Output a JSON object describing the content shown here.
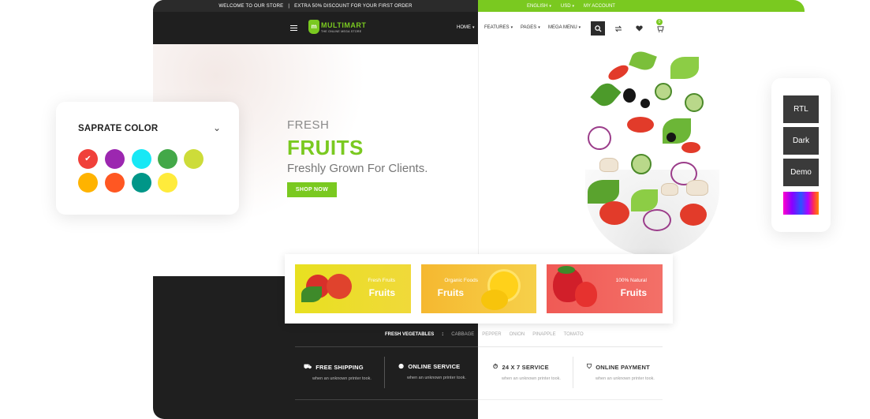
{
  "topbar": {
    "welcome": "WELCOME TO OUR STORE",
    "separator": "|",
    "discount": "EXTRA 50% DISCOUNT FOR YOUR FIRST ORDER",
    "language": "ENGLISH",
    "currency": "USD",
    "account": "MY ACCOUNT"
  },
  "header": {
    "logo_initial": "m",
    "logo_text": "MULTIMART",
    "logo_tagline": "THE ONLINE MEGA STORE",
    "nav": [
      "HOME",
      "FEATURES",
      "PAGES",
      "MEGA MENU"
    ],
    "cart_count": "0"
  },
  "hero": {
    "fresh": "FRESH",
    "title": "FRUITS",
    "subtitle": "Freshly Grown For Clients.",
    "cta": "SHOP NOW"
  },
  "cards": [
    {
      "name": "Fresh Fruits",
      "title": "Fruits"
    },
    {
      "name": "Organic Foods",
      "title": "Fruits"
    },
    {
      "name": "100% Natural",
      "title": "Fruits"
    }
  ],
  "tags": {
    "label": "FRESH VEGETABLES",
    "colon": ":",
    "items": [
      "CABBAGE",
      "PEPPER",
      "ONION",
      "PINAPPLE",
      "TOMATO"
    ]
  },
  "services": [
    {
      "title": "FREE SHIPPING",
      "desc": "when an unknown printer took.",
      "icon": "truck-icon"
    },
    {
      "title": "ONLINE SERVICE",
      "desc": "when an unknown printer took.",
      "icon": "user-icon"
    },
    {
      "title": "24 X 7 SERVICE",
      "desc": "when an unknown printer took.",
      "icon": "support-icon"
    },
    {
      "title": "ONLINE PAYMENT",
      "desc": "when an unknown printer took.",
      "icon": "payment-icon"
    }
  ],
  "color_panel": {
    "title": "SAPRATE COLOR",
    "swatches": [
      "#f0403a",
      "#9c27b0",
      "#18e8f5",
      "#43a848",
      "#cddc39",
      "#ffb300",
      "#ff5722",
      "#009688",
      "#ffeb3b"
    ],
    "selected": "#f0403a"
  },
  "side_panel": {
    "buttons": [
      "RTL",
      "Dark",
      "Demo"
    ]
  },
  "colors": {
    "accent": "#7ac920",
    "dark": "#1f1f1f"
  }
}
